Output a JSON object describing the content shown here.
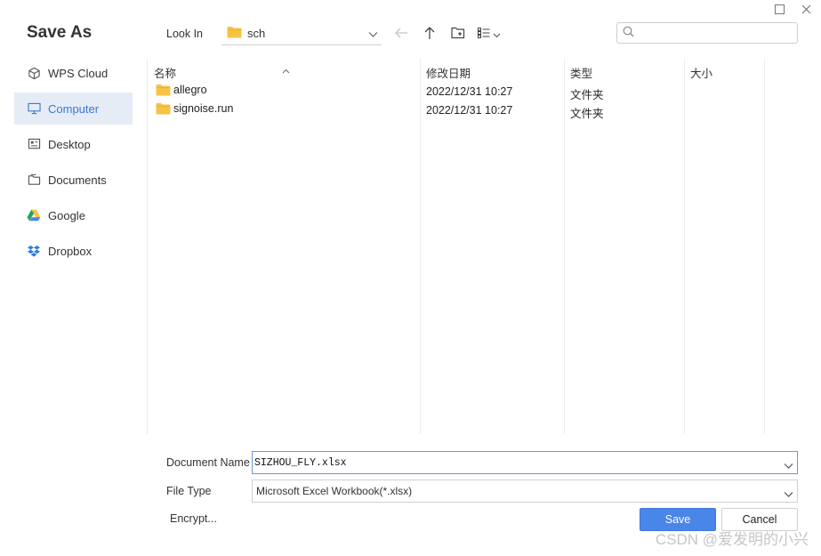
{
  "dialog": {
    "title": "Save As"
  },
  "sidebar": {
    "items": [
      {
        "label": "WPS Cloud",
        "icon": "cube-icon"
      },
      {
        "label": "Computer",
        "icon": "monitor-icon",
        "active": true
      },
      {
        "label": "Desktop",
        "icon": "desktop-icon"
      },
      {
        "label": "Documents",
        "icon": "documents-icon"
      },
      {
        "label": "Google",
        "icon": "google-drive-icon"
      },
      {
        "label": "Dropbox",
        "icon": "dropbox-icon"
      }
    ]
  },
  "toolbar": {
    "look_in_label": "Look In",
    "current_folder": "sch",
    "search_placeholder": ""
  },
  "file_list": {
    "columns": [
      "名称",
      "修改日期",
      "类型",
      "大小"
    ],
    "rows": [
      {
        "name": "allegro",
        "modified": "2022/12/31 10:27",
        "type": "文件夹",
        "size": ""
      },
      {
        "name": "signoise.run",
        "modified": "2022/12/31 10:27",
        "type": "文件夹",
        "size": ""
      }
    ]
  },
  "form": {
    "document_name_label": "Document Name",
    "document_name_value": "SIZHOU_FLY.xlsx",
    "file_type_label": "File Type",
    "file_type_value": "Microsoft Excel Workbook(*.xlsx)"
  },
  "actions": {
    "encrypt_label": "Encrypt...",
    "save_label": "Save",
    "cancel_label": "Cancel"
  },
  "watermark": {
    "text": "CSDN @爱发明的小兴"
  },
  "colors": {
    "accent": "#4a86e8",
    "active_bg": "#e6ecf5",
    "folder": "#f6c344"
  }
}
